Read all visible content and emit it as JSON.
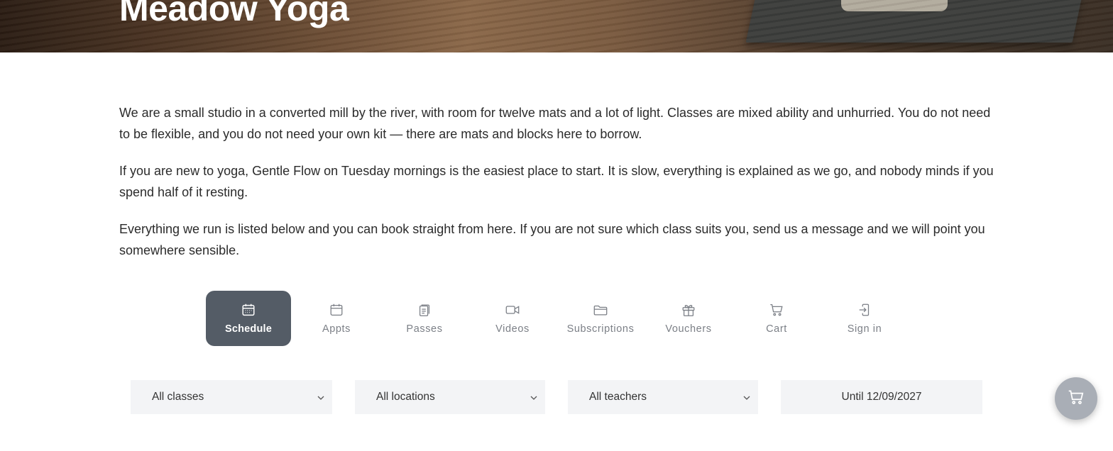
{
  "hero": {
    "title": "Meadow Yoga"
  },
  "intro": {
    "paragraphs": [
      "We are a small studio in a converted mill by the river, with room for twelve mats and a lot of light. Classes are mixed ability and unhurried. You do not need to be flexible, and you do not need your own kit — there are mats and blocks here to borrow.",
      "If you are new to yoga, Gentle Flow on Tuesday mornings is the easiest place to start. It is slow, everything is explained as we go, and nobody minds if you spend half of it resting.",
      "Everything we run is listed below and you can book straight from here. If you are not sure which class suits you, send us a message and we will point you somewhere sensible."
    ]
  },
  "tabs": [
    {
      "label": "Schedule",
      "icon": "calendar-icon",
      "active": true
    },
    {
      "label": "Appts",
      "icon": "calendar-outline-icon",
      "active": false
    },
    {
      "label": "Passes",
      "icon": "clipboard-icon",
      "active": false
    },
    {
      "label": "Videos",
      "icon": "video-camera-icon",
      "active": false
    },
    {
      "label": "Subscriptions",
      "icon": "folder-icon",
      "active": false
    },
    {
      "label": "Vouchers",
      "icon": "gift-icon",
      "active": false
    },
    {
      "label": "Cart",
      "icon": "cart-icon",
      "active": false
    },
    {
      "label": "Sign in",
      "icon": "sign-in-icon",
      "active": false
    }
  ],
  "filters": {
    "classes": "All classes",
    "locations": "All locations",
    "teachers": "All teachers",
    "date": "Until 12/09/2027"
  },
  "colors": {
    "active_tab": "#545c66",
    "filter_bg": "#f3f4f6",
    "cart_fab": "#a9aeb6"
  },
  "fab": {
    "icon": "cart-icon"
  }
}
